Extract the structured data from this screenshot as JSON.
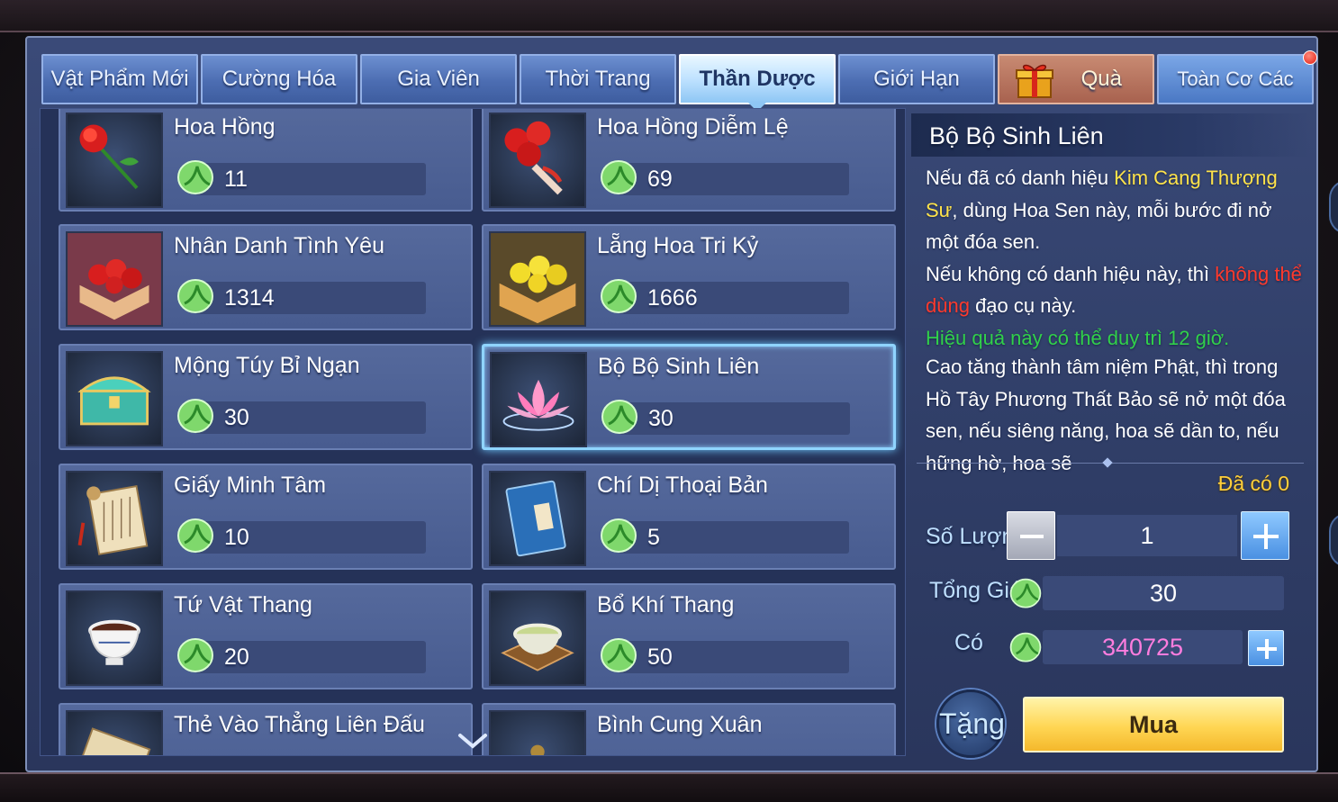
{
  "tabs": [
    {
      "label": "Vật Phẩm Mới"
    },
    {
      "label": "Cường Hóa"
    },
    {
      "label": "Gia Viên"
    },
    {
      "label": "Thời Trang"
    },
    {
      "label": "Thần Dược"
    },
    {
      "label": "Giới Hạn"
    },
    {
      "label": "Quà"
    },
    {
      "label": "Toàn Cơ Các"
    }
  ],
  "active_tab": "Thần Dược",
  "items": [
    {
      "name": "Hoa Hồng",
      "price": "11"
    },
    {
      "name": "Hoa Hồng Diễm Lệ",
      "price": "69"
    },
    {
      "name": "Nhân Danh Tình Yêu",
      "price": "1314"
    },
    {
      "name": "Lẵng Hoa Tri Kỷ",
      "price": "1666"
    },
    {
      "name": "Mộng Túy Bỉ Ngạn",
      "price": "30"
    },
    {
      "name": "Bộ Bộ Sinh Liên",
      "price": "30"
    },
    {
      "name": "Giấy Minh Tâm",
      "price": "10"
    },
    {
      "name": "Chí Dị Thoại Bản",
      "price": "5"
    },
    {
      "name": "Tứ Vật Thang",
      "price": "20"
    },
    {
      "name": "Bổ Khí Thang",
      "price": "50"
    },
    {
      "name": "Thẻ Vào Thẳng Liên Đấu",
      "price": ""
    },
    {
      "name": "Bình Cung Xuân",
      "price": ""
    }
  ],
  "selected_item": "Bộ Bộ Sinh Liên",
  "detail": {
    "title": "Bộ Bộ Sinh Liên",
    "desc": {
      "p1": "Nếu đã có danh hiệu ",
      "highlight_title": "Kim Cang Thượng Sư",
      "p2": ", dùng Hoa Sen này, mỗi bước đi nở một đóa sen.",
      "p3": "Nếu không có danh hiệu này, thì ",
      "warn": "không thể dùng",
      "p4": " đạo cụ này.",
      "effect": "Hiệu quả này có thể duy trì 12 giờ."
    },
    "lore": "Cao tăng thành tâm niệm Phật, thì trong Hồ Tây Phương Thất Bảo sẽ nở một đóa sen, nếu siêng năng, hoa sẽ dần to, nếu hững hờ, hoa sẽ",
    "owned": "Đã có 0",
    "qty_label": "Số Lượng",
    "qty_value": "1",
    "total_label": "Tổng Giá",
    "total_value": "30",
    "have_label": "Có",
    "have_value": "340725",
    "gift_label": "Tặng",
    "buy_label": "Mua"
  },
  "colors": {
    "panel": "#3a4a78",
    "active_tab": "#bfe2ff",
    "buy": "#ffd653",
    "highlight_yellow": "#ffe34a",
    "warn_red": "#ff3a2c",
    "effect_green": "#31d04a",
    "balance_pink": "#ff7ddf"
  },
  "icons": {
    "currency": "jade-leaf-icon",
    "gift": "gift-box-icon",
    "scroll_down": "chevron-down-icon"
  }
}
